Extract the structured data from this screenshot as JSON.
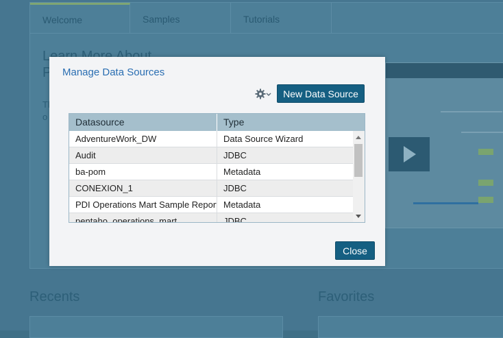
{
  "background": {
    "tabs": [
      "Welcome",
      "Samples",
      "Tutorials"
    ],
    "hero_title_line1": "Learn More About",
    "hero_title_line2": "P",
    "hero_text_line1": "Th",
    "hero_text_line2": "o",
    "recents_title": "Recents",
    "favorites_title": "Favorites"
  },
  "dialog": {
    "title": "Manage Data Sources",
    "gear_icon": "gear-icon",
    "new_button_label": "New Data Source",
    "close_button_label": "Close",
    "table": {
      "columns": [
        "Datasource",
        "Type"
      ],
      "rows": [
        [
          "AdventureWork_DW",
          "Data Source Wizard"
        ],
        [
          "Audit",
          "JDBC"
        ],
        [
          "ba-pom",
          "Metadata"
        ],
        [
          "CONEXION_1",
          "JDBC"
        ],
        [
          "PDI Operations Mart Sample Reports",
          "Metadata"
        ],
        [
          "pentaho_operations_mart",
          "JDBC"
        ]
      ]
    }
  },
  "colors": {
    "primary_button": "#155f82",
    "title_link": "#2a6eb2",
    "table_header": "#a5bfcc"
  }
}
